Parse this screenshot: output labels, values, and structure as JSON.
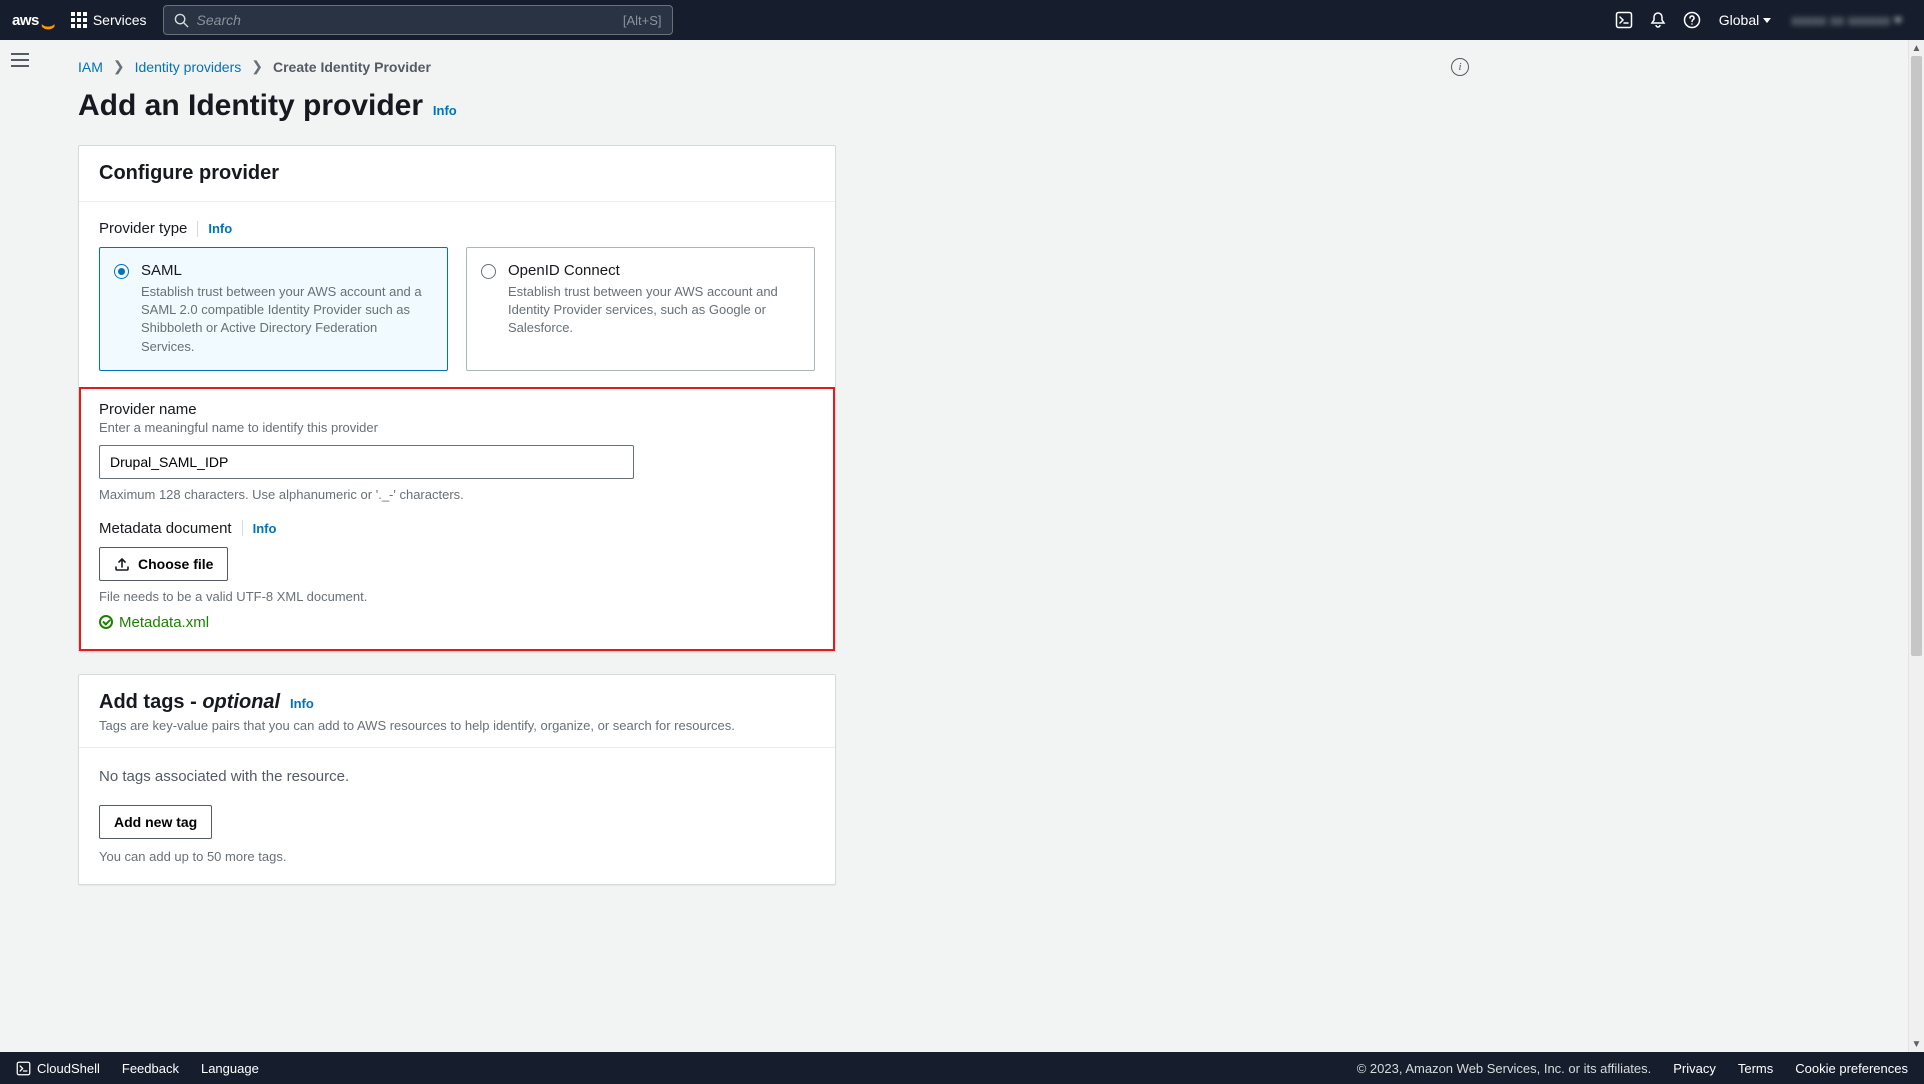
{
  "nav": {
    "logo_text": "aws",
    "services": "Services",
    "search_placeholder": "Search",
    "shortcut": "[Alt+S]",
    "region": "Global",
    "account": "xxxxx xx xxxxxx"
  },
  "breadcrumb": {
    "iam": "IAM",
    "idp": "Identity providers",
    "current": "Create Identity Provider"
  },
  "page": {
    "title": "Add an Identity provider",
    "info": "Info"
  },
  "configure": {
    "heading": "Configure provider",
    "provider_type_label": "Provider type",
    "info": "Info",
    "saml": {
      "title": "SAML",
      "desc": "Establish trust between your AWS account and a SAML 2.0 compatible Identity Provider such as Shibboleth or Active Directory Federation Services."
    },
    "oidc": {
      "title": "OpenID Connect",
      "desc": "Establish trust between your AWS account and Identity Provider services, such as Google or Salesforce."
    },
    "provider_name_label": "Provider name",
    "provider_name_sub": "Enter a meaningful name to identify this provider",
    "provider_name_value": "Drupal_SAML_IDP",
    "provider_name_hint": "Maximum 128 characters. Use alphanumeric or '._-' characters.",
    "metadata_label": "Metadata document",
    "choose_file": "Choose file",
    "metadata_hint": "File needs to be a valid UTF-8 XML document.",
    "uploaded_file": "Metadata.xml"
  },
  "tags": {
    "title_a": "Add tags - ",
    "title_b": "optional",
    "info": "Info",
    "desc": "Tags are key-value pairs that you can add to AWS resources to help identify, organize, or search for resources.",
    "empty": "No tags associated with the resource.",
    "add_btn": "Add new tag",
    "limit": "You can add up to 50 more tags."
  },
  "footer": {
    "cloudshell": "CloudShell",
    "feedback": "Feedback",
    "language": "Language",
    "copyright": "© 2023, Amazon Web Services, Inc. or its affiliates.",
    "privacy": "Privacy",
    "terms": "Terms",
    "cookies": "Cookie preferences"
  }
}
